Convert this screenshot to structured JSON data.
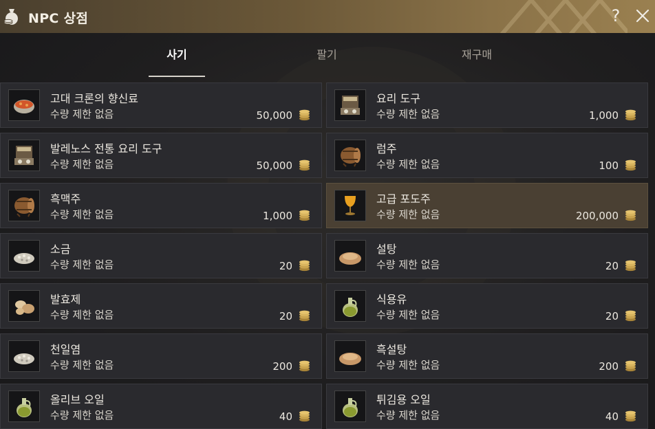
{
  "window": {
    "title": "NPC 상점",
    "help_label": "?",
    "title_icon": "money-bag-icon",
    "close_icon": "close-icon"
  },
  "tabs": [
    {
      "label": "사기",
      "active": true
    },
    {
      "label": "팔기",
      "active": false
    },
    {
      "label": "재구매",
      "active": false
    }
  ],
  "items": [
    {
      "name": "고대 크론의 향신료",
      "limit": "수량 제한 없음",
      "price": "50,000",
      "icon": "spice-bowl-icon"
    },
    {
      "name": "요리 도구",
      "limit": "수량 제한 없음",
      "price": "1,000",
      "icon": "cooking-utensil-icon"
    },
    {
      "name": "발레노스 전통 요리 도구",
      "limit": "수량 제한 없음",
      "price": "50,000",
      "icon": "cooking-utensil-icon"
    },
    {
      "name": "럼주",
      "limit": "수량 제한 없음",
      "price": "100",
      "icon": "barrel-icon"
    },
    {
      "name": "흑맥주",
      "limit": "수량 제한 없음",
      "price": "1,000",
      "icon": "barrel-icon"
    },
    {
      "name": "고급 포도주",
      "limit": "수량 제한 없음",
      "price": "200,000",
      "icon": "goblet-icon",
      "selected": true
    },
    {
      "name": "소금",
      "limit": "수량 제한 없음",
      "price": "20",
      "icon": "salt-pile-icon"
    },
    {
      "name": "설탕",
      "limit": "수량 제한 없음",
      "price": "20",
      "icon": "sugar-pile-icon"
    },
    {
      "name": "발효제",
      "limit": "수량 제한 없음",
      "price": "20",
      "icon": "leaven-icon"
    },
    {
      "name": "식용유",
      "limit": "수량 제한 없음",
      "price": "20",
      "icon": "oil-jar-icon"
    },
    {
      "name": "천일염",
      "limit": "수량 제한 없음",
      "price": "200",
      "icon": "salt-pile-icon"
    },
    {
      "name": "흑설탕",
      "limit": "수량 제한 없음",
      "price": "200",
      "icon": "sugar-pile-icon"
    },
    {
      "name": "올리브 오일",
      "limit": "수량 제한 없음",
      "price": "40",
      "icon": "oil-jar-icon"
    },
    {
      "name": "튀김용 오일",
      "limit": "수량 제한 없음",
      "price": "40",
      "icon": "oil-jar-icon"
    }
  ],
  "colors": {
    "title_bar": "#6b5838",
    "card": "#2a2a2e",
    "card_selected": "#4a4033",
    "coin": "#c9a34e"
  }
}
